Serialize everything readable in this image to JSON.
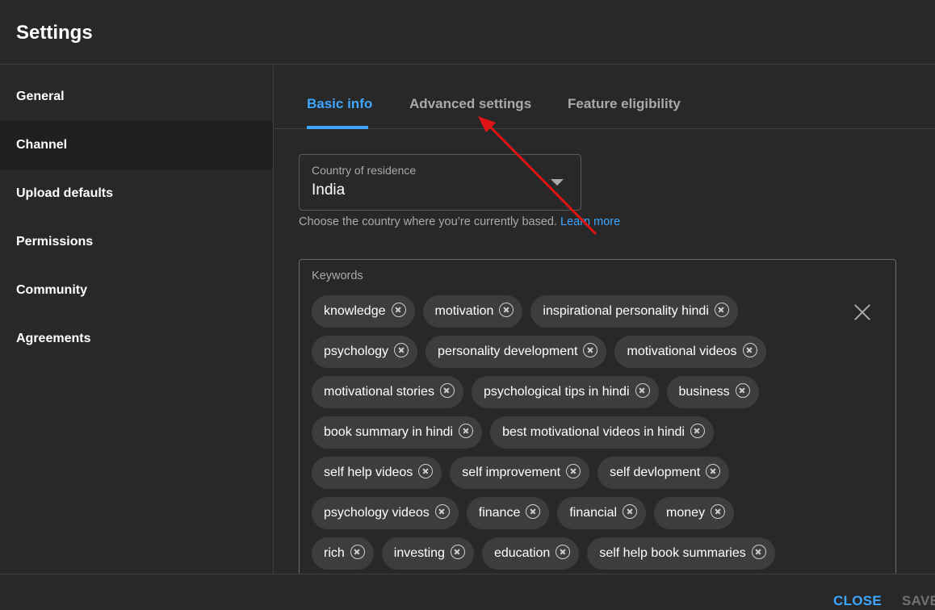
{
  "header": {
    "title": "Settings"
  },
  "sidebar": {
    "items": [
      {
        "label": "General"
      },
      {
        "label": "Channel"
      },
      {
        "label": "Upload defaults"
      },
      {
        "label": "Permissions"
      },
      {
        "label": "Community"
      },
      {
        "label": "Agreements"
      }
    ],
    "active": "Channel"
  },
  "tabs": [
    {
      "label": "Basic info"
    },
    {
      "label": "Advanced settings"
    },
    {
      "label": "Feature eligibility"
    }
  ],
  "active_tab": "Basic info",
  "country": {
    "label": "Country of residence",
    "value": "India",
    "helper": "Choose the country where you’re currently based.",
    "learn_more": "Learn more"
  },
  "keywords": {
    "label": "Keywords",
    "rows": [
      [
        "knowledge",
        "motivation",
        "inspirational personality hindi"
      ],
      [
        "psychology",
        "personality development",
        "motivational videos"
      ],
      [
        "motivational stories",
        "psychological tips in hindi",
        "business"
      ],
      [
        "book summary in hindi",
        "best motivational videos in hindi"
      ],
      [
        "self help videos",
        "self improvement",
        "self devlopment"
      ],
      [
        "psychology videos",
        "finance",
        "financial",
        "money"
      ],
      [
        "rich",
        "investing",
        "education",
        "self help book summaries"
      ]
    ]
  },
  "footer": {
    "close_label": "CLOSE",
    "save_label": "SAVE"
  },
  "colors": {
    "background": "#282828",
    "accent": "#3ea6ff",
    "chip": "#3d3d3d",
    "annotation_arrow": "#e01414"
  }
}
